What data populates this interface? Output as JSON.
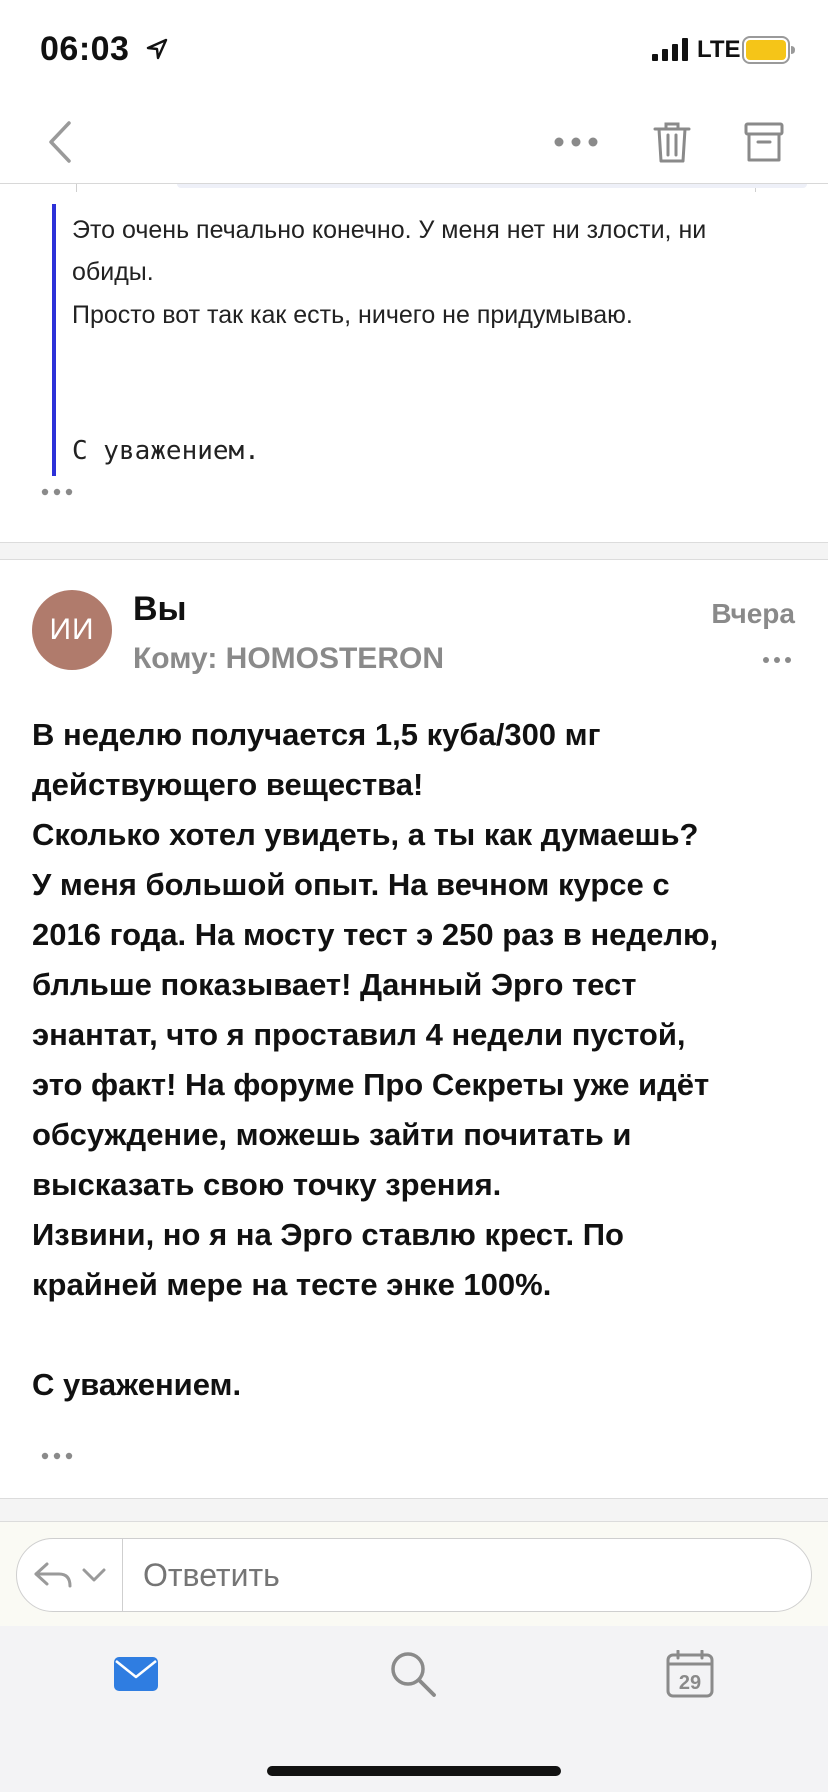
{
  "status_bar": {
    "time": "06:03",
    "network": "LTE",
    "location_icon": "location-arrow-icon",
    "signal_icon": "signal-bars-icon",
    "battery_icon": "battery-icon",
    "battery_color": "#f5c518"
  },
  "toolbar": {
    "back_icon": "chevron-left-icon",
    "more_icon": "more-horizontal-icon",
    "delete_icon": "trash-icon",
    "archive_icon": "archive-icon"
  },
  "previous_message": {
    "quote_lines": [
      "Это очень печально конечно. У меня нет ни злости, ни обиды.",
      "Просто вот так как есть, ничего не придумываю."
    ],
    "signature": "С уважением.",
    "quote_color": "#2c31d8"
  },
  "message": {
    "avatar_initials": "ИИ",
    "avatar_color": "#b07b6c",
    "sender": "Вы",
    "recipient": "Кому: HOMOSTERON",
    "date": "Вчера",
    "body_lines": [
      "В неделю получается 1,5 куба/300 мг",
      "действующего вещества!",
      "Сколько хотел увидеть, а ты как думаешь?",
      "У меня большой опыт. На вечном курсе с",
      "2016 года. На мосту тест э 250 раз в неделю,",
      "блльше показывает! Данный Эрго тест",
      "энантат, что я проставил 4 недели пустой,",
      "это факт! На форуме Про Секреты уже идёт",
      "обсуждение, можешь зайти почитать и",
      "высказать свою точку зрения.",
      "Извини, но я на Эрго ставлю крест. По",
      "крайней мере на тесте энке 100%."
    ],
    "signature": "С уважением."
  },
  "reply": {
    "placeholder": "Ответить",
    "reply_icon": "reply-arrow-icon",
    "dropdown_icon": "chevron-down-icon"
  },
  "tab_bar": {
    "mail_icon": "mail-envelope-icon",
    "search_icon": "search-icon",
    "calendar_icon": "calendar-icon",
    "calendar_day": "29",
    "active_color": "#2f7de1"
  }
}
